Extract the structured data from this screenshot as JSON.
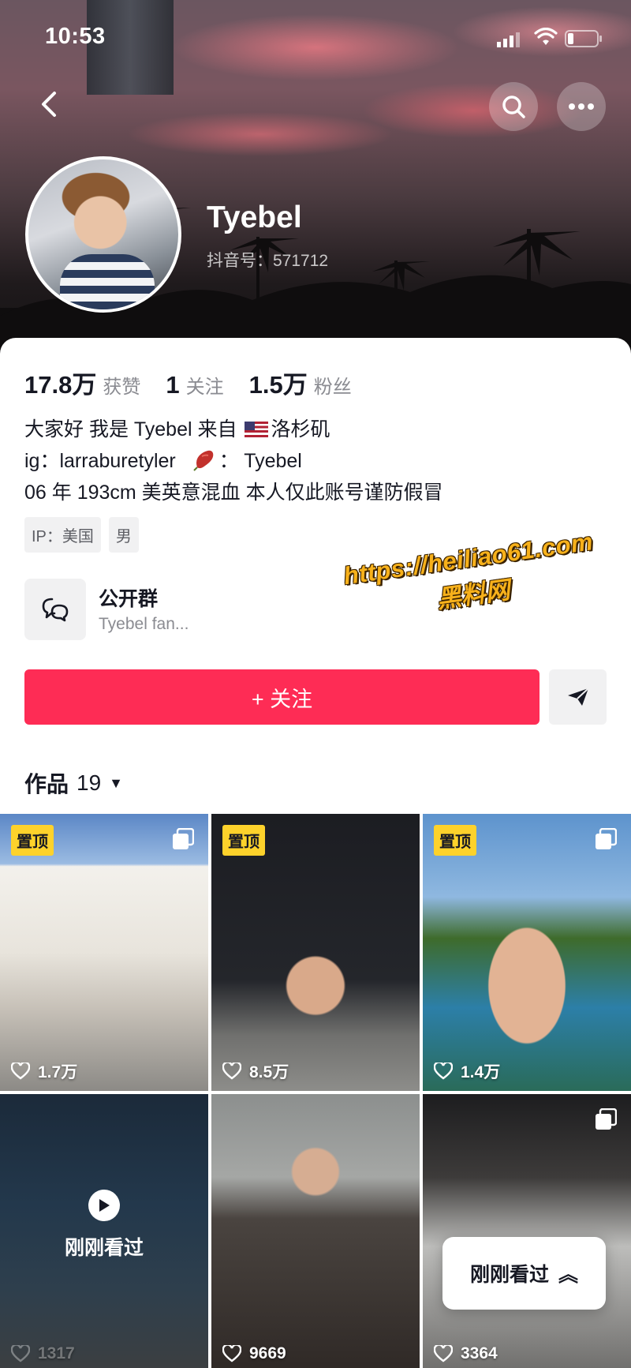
{
  "status_bar": {
    "time": "10:53"
  },
  "profile": {
    "username": "Tyebel",
    "douyin_id": "抖音号：571712",
    "stats": [
      {
        "value": "17.8万",
        "label": "获赞"
      },
      {
        "value": "1",
        "label": "关注"
      },
      {
        "value": "1.5万",
        "label": "粉丝"
      }
    ],
    "bio": {
      "line1_a": "大家好 我是 Tyebel 来自",
      "line1_b": "洛杉矶",
      "line2_a": "ig：larraburetyler",
      "line2_b": "：  Tyebel",
      "line3": "06 年 193cm 美英意混血 本人仅此账号谨防假冒"
    },
    "tags": [
      "IP：美国",
      "男"
    ],
    "group": {
      "title": "公开群",
      "subtitle": "Tyebel fan..."
    },
    "follow_label": "+ 关注"
  },
  "watermark": {
    "line1": "https://heiliao61.com",
    "line2": "黑料网"
  },
  "works": {
    "label": "作品",
    "count": "19",
    "caret": "▼"
  },
  "grid": [
    {
      "pinned": "置顶",
      "likes": "1.7万"
    },
    {
      "pinned": "置顶",
      "likes": "8.5万"
    },
    {
      "pinned": "置顶",
      "likes": "1.4万"
    },
    {
      "seen": "刚刚看过",
      "likes": "1317"
    },
    {
      "likes": "9669"
    },
    {
      "likes": "3364"
    }
  ],
  "recent_pill": {
    "label": "刚刚看过",
    "chevron": "︽"
  },
  "icons": {
    "back": "chevron-left-icon",
    "search": "search-icon",
    "more": "more-dots-icon",
    "share": "send-icon",
    "group": "chat-bubbles-icon",
    "heart": "heart-outline-icon",
    "multi": "multi-image-icon",
    "play": "play-icon"
  },
  "colors": {
    "accent": "#fe2c55",
    "pin": "#fdd22b",
    "watermark": "#f7b11b"
  }
}
